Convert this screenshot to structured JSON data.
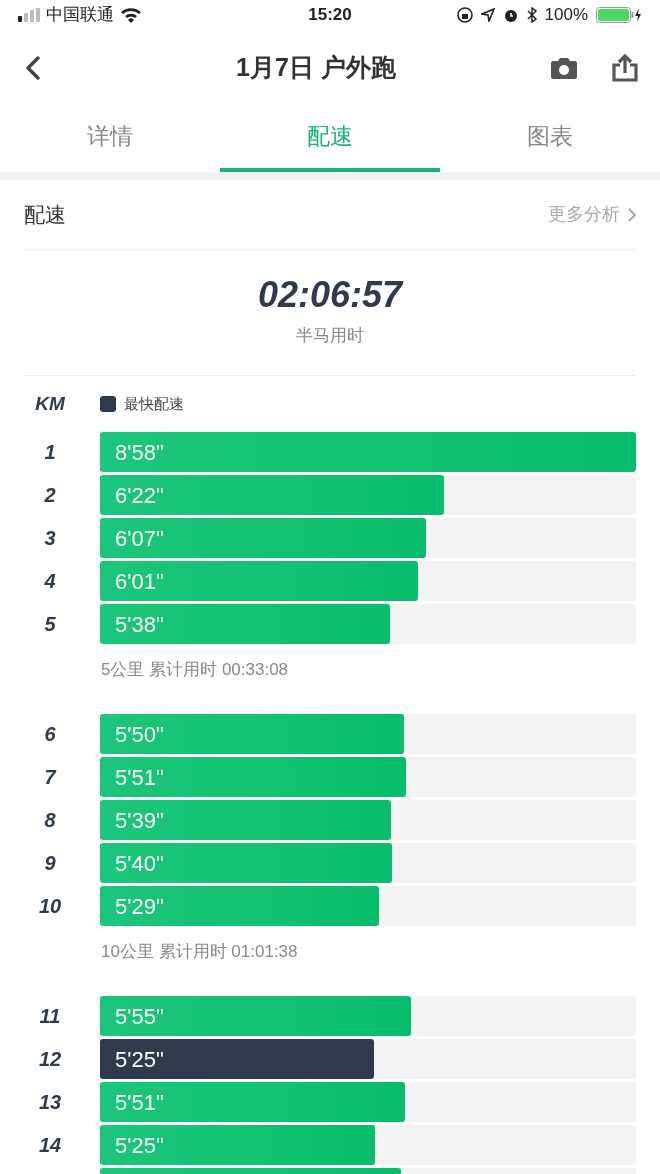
{
  "status_bar": {
    "carrier": "中国联通",
    "time": "15:20",
    "battery": "100%"
  },
  "nav": {
    "title": "1月7日 户外跑"
  },
  "tabs": [
    {
      "label": "详情",
      "selected": false
    },
    {
      "label": "配速",
      "selected": true
    },
    {
      "label": "图表",
      "selected": false
    }
  ],
  "section": {
    "title": "配速",
    "link": "更多分析"
  },
  "total": {
    "value": "02:06:57",
    "label": "半马用时"
  },
  "legend": {
    "axis": "KM",
    "label": "最快配速"
  },
  "groups": [
    {
      "rows": [
        {
          "km": "1",
          "pace": "8'58\"",
          "level": 1.0,
          "fastest": false
        },
        {
          "km": "2",
          "pace": "6'22\"",
          "level": 0.642,
          "fastest": false
        },
        {
          "km": "3",
          "pace": "6'07\"",
          "level": 0.608,
          "fastest": false
        },
        {
          "km": "4",
          "pace": "6'01\"",
          "level": 0.593,
          "fastest": false
        },
        {
          "km": "5",
          "pace": "5'38\"",
          "level": 0.541,
          "fastest": false
        }
      ],
      "summary": "5公里 累计用时 00:33:08"
    },
    {
      "rows": [
        {
          "km": "6",
          "pace": "5'50\"",
          "level": 0.567,
          "fastest": false
        },
        {
          "km": "7",
          "pace": "5'51\"",
          "level": 0.571,
          "fastest": false
        },
        {
          "km": "8",
          "pace": "5'39\"",
          "level": 0.543,
          "fastest": false
        },
        {
          "km": "9",
          "pace": "5'40\"",
          "level": 0.545,
          "fastest": false
        },
        {
          "km": "10",
          "pace": "5'29\"",
          "level": 0.521,
          "fastest": false
        }
      ],
      "summary": "10公里 累计用时 01:01:38"
    },
    {
      "rows": [
        {
          "km": "11",
          "pace": "5'55\"",
          "level": 0.58,
          "fastest": false
        },
        {
          "km": "12",
          "pace": "5'25\"",
          "level": 0.511,
          "fastest": true
        },
        {
          "km": "13",
          "pace": "5'51\"",
          "level": 0.569,
          "fastest": false
        },
        {
          "km": "14",
          "pace": "5'25\"",
          "level": 0.513,
          "fastest": false
        },
        {
          "level": 0.562,
          "fastest": false
        }
      ]
    }
  ]
}
